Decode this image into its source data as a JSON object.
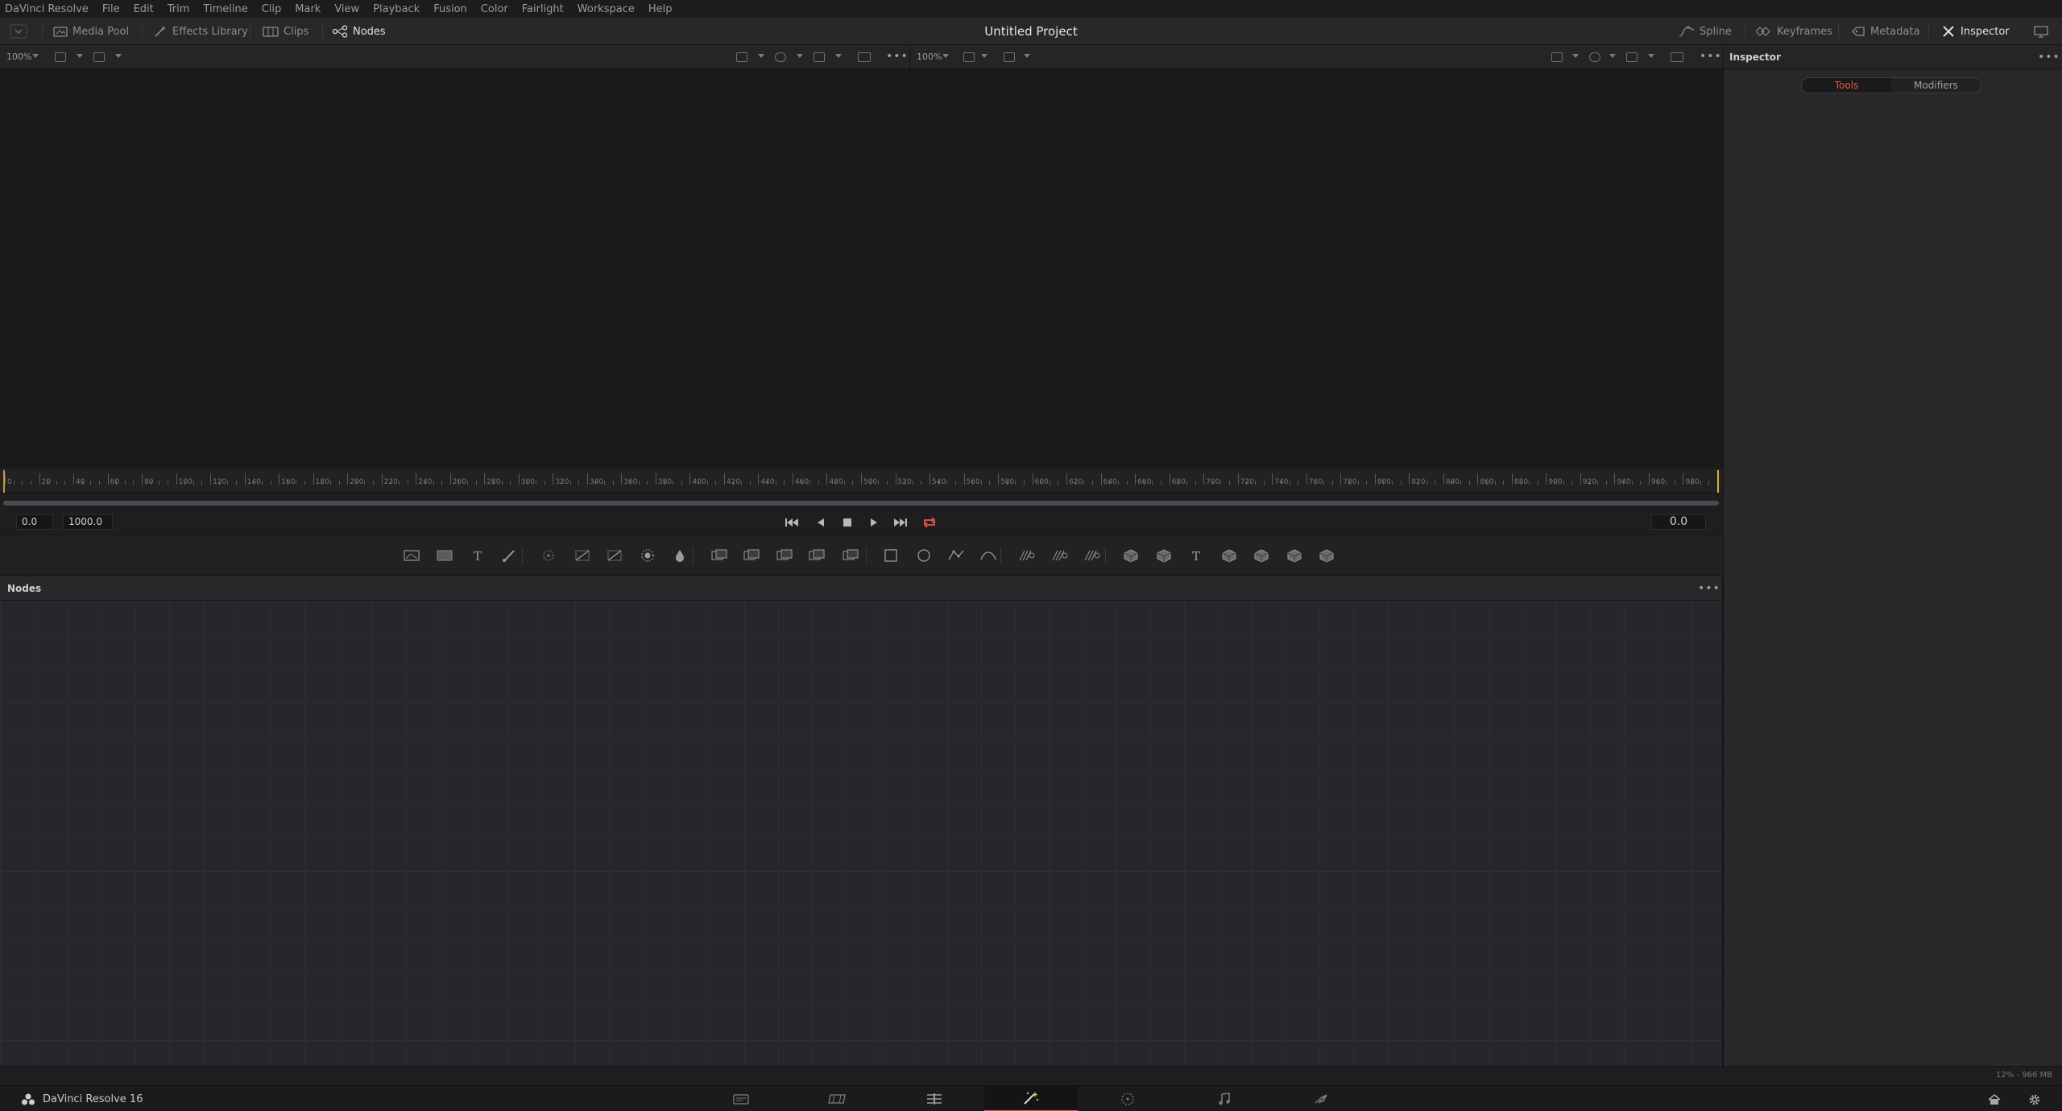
{
  "menu": [
    "DaVinci Resolve",
    "File",
    "Edit",
    "Trim",
    "Timeline",
    "Clip",
    "Mark",
    "View",
    "Playback",
    "Fusion",
    "Color",
    "Fairlight",
    "Workspace",
    "Help"
  ],
  "toolbar": {
    "media_pool": "Media Pool",
    "effects_library": "Effects Library",
    "clips": "Clips",
    "nodes": "Nodes",
    "project_title": "Untitled Project",
    "spline": "Spline",
    "keyframes": "Keyframes",
    "metadata": "Metadata",
    "inspector": "Inspector"
  },
  "viewer_left": {
    "zoom": "100%"
  },
  "viewer_right": {
    "zoom": "100%"
  },
  "ruler": {
    "start": 0,
    "end": 1000,
    "step": 20,
    "labels": [
      "0",
      "20",
      "40",
      "60",
      "80",
      "100",
      "120",
      "140",
      "160",
      "180",
      "200",
      "220",
      "240",
      "260",
      "280",
      "300",
      "320",
      "340",
      "360",
      "380",
      "400",
      "420",
      "440",
      "460",
      "480",
      "500",
      "520",
      "540",
      "560",
      "580",
      "600",
      "620",
      "640",
      "660",
      "680",
      "700",
      "720",
      "740",
      "760",
      "780",
      "800",
      "820",
      "840",
      "860",
      "880",
      "900",
      "920",
      "940",
      "960",
      "980"
    ]
  },
  "transport": {
    "global_start": "0.0",
    "global_end": "1000.0",
    "current_time": "0.0",
    "loop_color": "#e8574a"
  },
  "nodes_panel": {
    "title": "Nodes"
  },
  "inspector": {
    "title": "Inspector",
    "tabs": [
      "Tools",
      "Modifiers"
    ],
    "active_tab": "Tools"
  },
  "status": {
    "memory": "12% - 966 MB"
  },
  "pagebar": {
    "brand": "DaVinci Resolve 16",
    "pages": [
      "media-icon",
      "cut-icon",
      "edit-icon",
      "fusion-icon",
      "color-icon",
      "fairlight-icon",
      "deliver-icon"
    ],
    "active_page": "fusion-icon",
    "accent": "#e8574a"
  }
}
